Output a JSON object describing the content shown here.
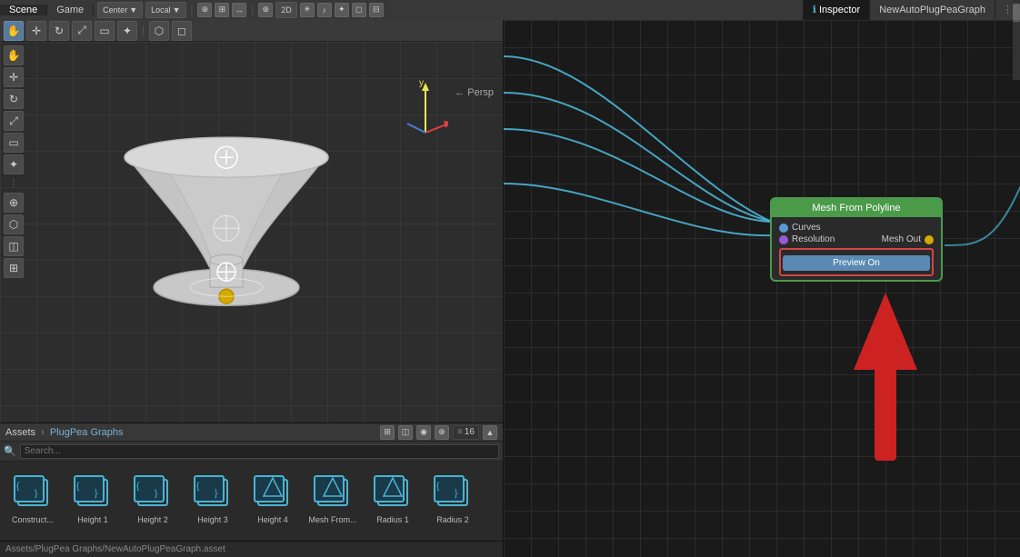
{
  "tabs": {
    "scene": "Scene",
    "game": "Game",
    "inspector": "Inspector",
    "newAutoPlugPeaGraph": "NewAutoPlugPeaGraph"
  },
  "toolbar": {
    "center_label": "Center",
    "local_label": "Local",
    "persp_label": "← Persp",
    "y_label": "y",
    "mode_2d": "2D",
    "icons": [
      "hand",
      "move",
      "rotate",
      "scale",
      "rect",
      "transform"
    ]
  },
  "scene": {
    "toolbar_icons": [
      "hand-icon",
      "move-icon",
      "rotate-icon",
      "scale-icon",
      "rect-icon",
      "transform-icon",
      "settings-icon"
    ]
  },
  "node": {
    "title": "Mesh From Polyline",
    "port_curves": "Curves",
    "port_resolution": "Resolution",
    "port_mesh_out": "Mesh Out",
    "button_label": "Preview On",
    "border_color": "#d44444"
  },
  "assets": {
    "breadcrumb_root": "Assets",
    "breadcrumb_sep": "›",
    "breadcrumb_folder": "PlugPea Graphs",
    "items": [
      {
        "label": "Construct...",
        "icon": "cube-brackets"
      },
      {
        "label": "Height 1",
        "icon": "cube-brackets"
      },
      {
        "label": "Height 2",
        "icon": "cube-brackets"
      },
      {
        "label": "Height 3",
        "icon": "cube-brackets"
      },
      {
        "label": "Height 4",
        "icon": "cube"
      },
      {
        "label": "Mesh From...",
        "icon": "cube"
      },
      {
        "label": "Radius 1",
        "icon": "cube"
      },
      {
        "label": "Radius 2",
        "icon": "cube-brackets"
      }
    ]
  },
  "status_bar": {
    "path": "Assets/PlugPea Graphs/NewAutoPlugPeaGraph.asset"
  },
  "icons": {
    "search": "🔍",
    "more": "⋮",
    "settings": "⚙",
    "arrow_down": "▼",
    "arrow_right": "▶",
    "eye": "👁",
    "grid": "⊞"
  },
  "colors": {
    "green_border": "#4a9a4a",
    "red_border": "#d44444",
    "blue_port": "#5a9ad4",
    "purple_port": "#9a5ad4",
    "yellow_port": "#d4aa00",
    "curve_color": "#4ab4d4",
    "node_header_bg": "#4a9a4a"
  }
}
